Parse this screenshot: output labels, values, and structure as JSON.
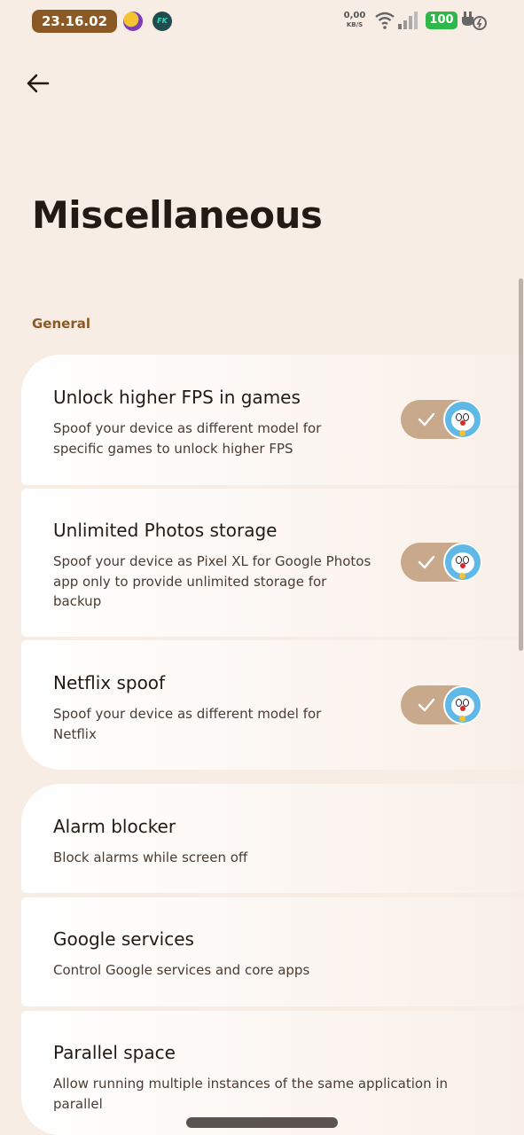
{
  "status_bar": {
    "time": "23.16.02",
    "app_icon_2_text": "FK",
    "net_speed": "0,00",
    "net_unit": "KB/S",
    "battery": "100"
  },
  "header": {
    "title": "Miscellaneous"
  },
  "section": {
    "title": "General"
  },
  "items": [
    {
      "title": "Unlock higher FPS in games",
      "desc": "Spoof your device as different model for specific games to unlock higher FPS",
      "toggle": true
    },
    {
      "title": "Unlimited Photos storage",
      "desc": "Spoof your device as Pixel XL for Google Photos app only to provide unlimited storage for backup",
      "toggle": true
    },
    {
      "title": "Netflix spoof",
      "desc": "Spoof your device as different model for Netflix",
      "toggle": true
    },
    {
      "title": "Alarm blocker",
      "desc": "Block alarms while screen off"
    },
    {
      "title": "Google services",
      "desc": "Control Google services and core apps"
    },
    {
      "title": "Parallel space",
      "desc": "Allow running multiple instances of the same application in parallel"
    }
  ],
  "colors": {
    "background": "#f8ede5",
    "accent": "#8b5a24",
    "toggle_track": "#c8a98b",
    "battery": "#2fb84a"
  }
}
